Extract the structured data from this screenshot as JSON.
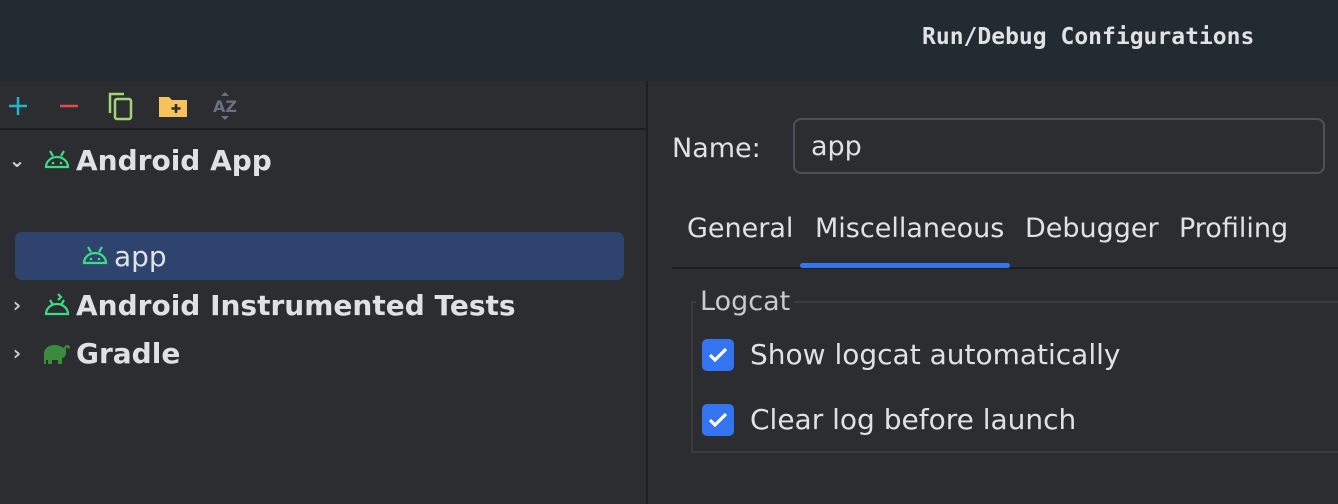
{
  "window": {
    "title": "Run/Debug Configurations"
  },
  "toolbar": {
    "add": "add-icon",
    "remove": "remove-icon",
    "copy": "copy-icon",
    "new_folder": "new-folder-icon",
    "sort": "sort-alphabetically-icon"
  },
  "tree": [
    {
      "label": "Android App",
      "expanded": true,
      "children": [
        {
          "label": "app",
          "selected": true
        }
      ]
    },
    {
      "label": "Android Instrumented Tests",
      "expanded": false
    },
    {
      "label": "Gradle",
      "expanded": false
    }
  ],
  "form": {
    "name_label": "Name:",
    "name_value": "app",
    "tabs": [
      "General",
      "Miscellaneous",
      "Debugger",
      "Profiling"
    ],
    "active_tab": "Miscellaneous",
    "group_title": "Logcat",
    "options": [
      {
        "label": "Show logcat automatically",
        "checked": true
      },
      {
        "label": "Clear log before launch",
        "checked": true
      }
    ]
  },
  "colors": {
    "accent": "#3574f0",
    "selection": "#2e436e",
    "android": "#3ddc84",
    "gradle": "#3b8b3f"
  }
}
